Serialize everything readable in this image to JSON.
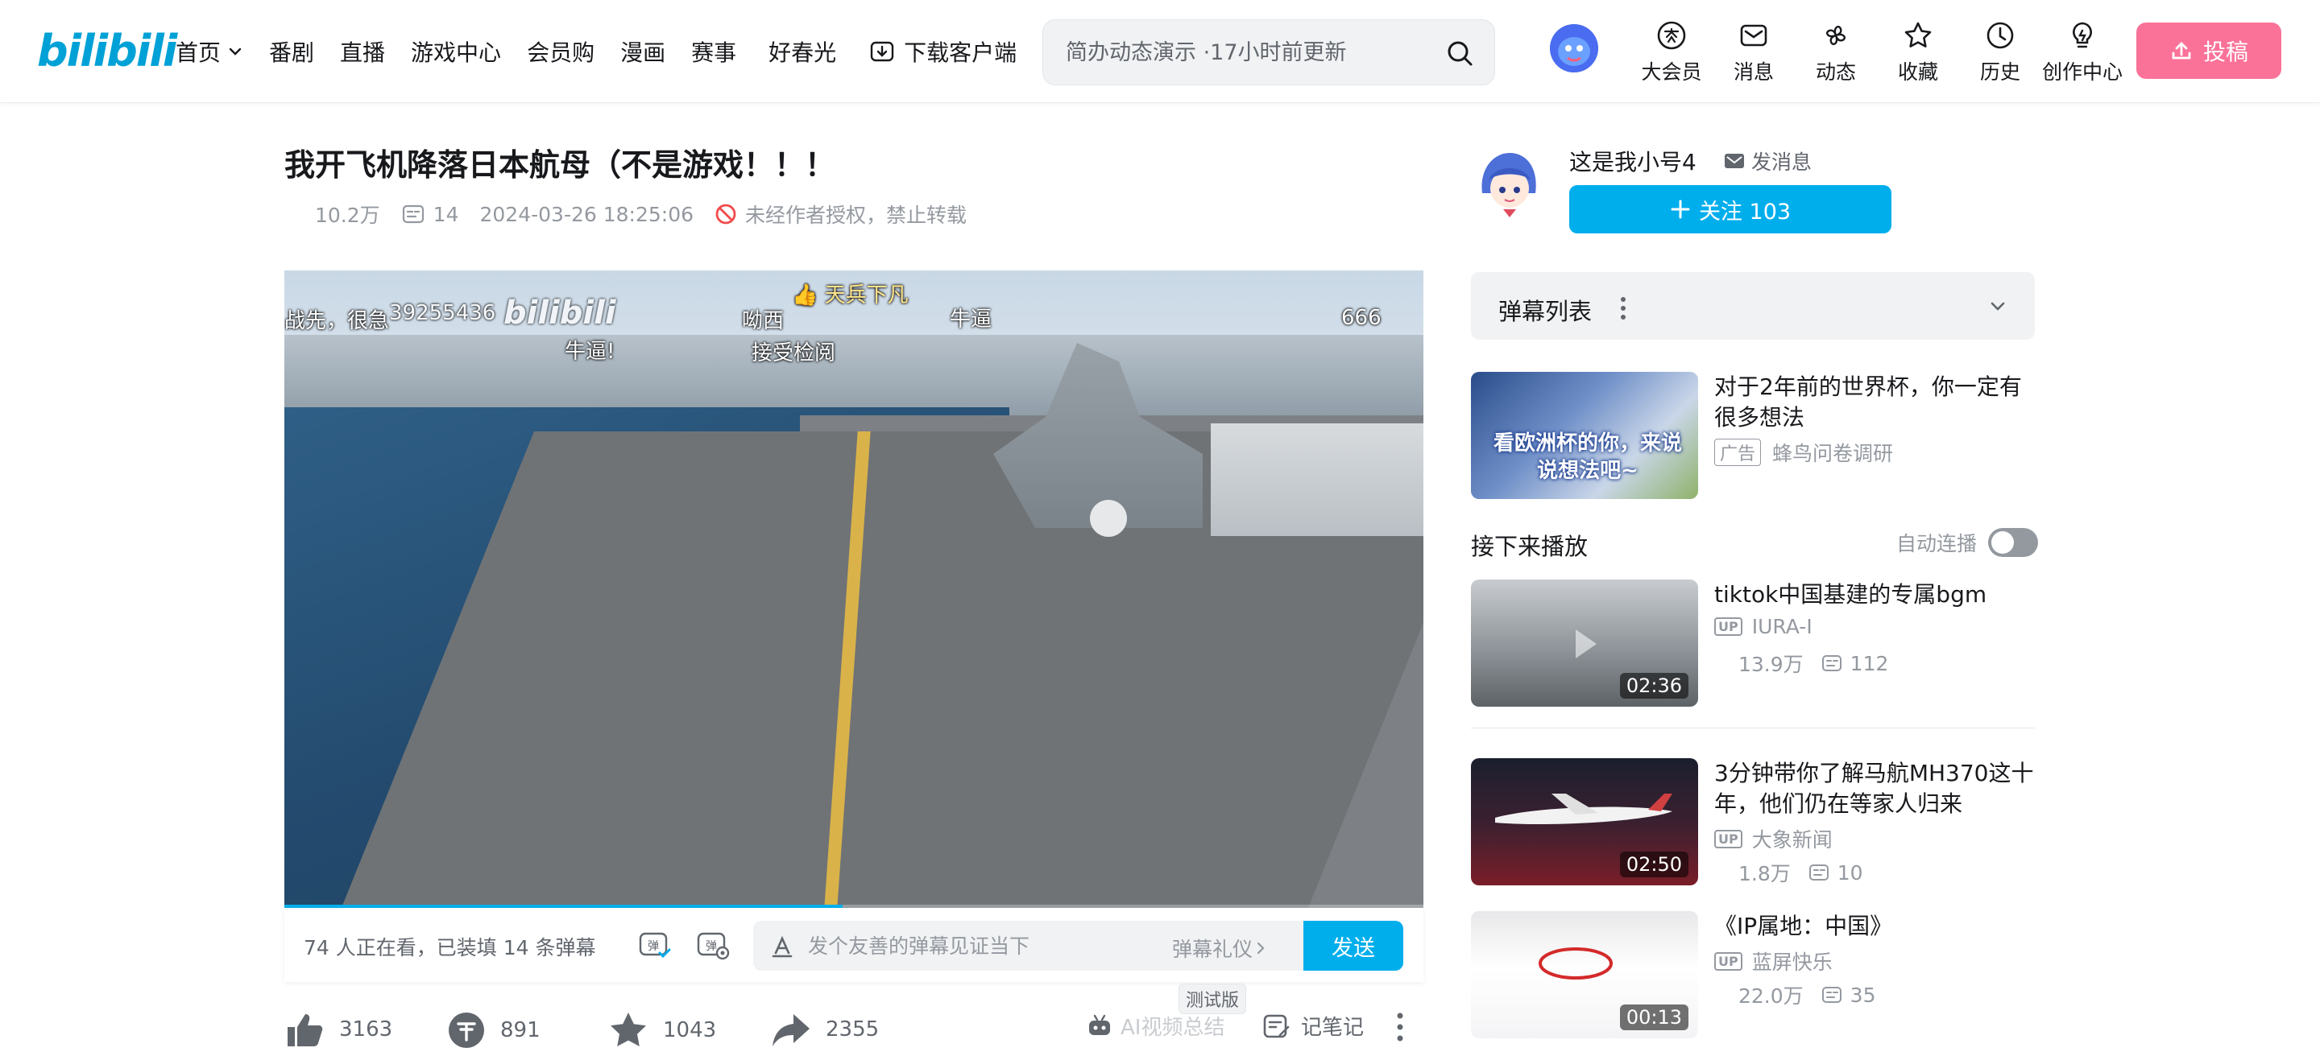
{
  "header": {
    "logo": "bilibili",
    "nav": [
      {
        "label": "首页"
      },
      {
        "label": "番剧"
      },
      {
        "label": "直播"
      },
      {
        "label": "游戏中心"
      },
      {
        "label": "会员购"
      },
      {
        "label": "漫画"
      },
      {
        "label": "赛事"
      },
      {
        "label": "好春光"
      },
      {
        "label": "下载客户端"
      }
    ],
    "search_placeholder": "简办动态演示 ·17小时前更新",
    "icons": [
      {
        "label": "大会员",
        "icon": "vip-icon"
      },
      {
        "label": "消息",
        "icon": "message-icon"
      },
      {
        "label": "动态",
        "icon": "dynamic-icon"
      },
      {
        "label": "收藏",
        "icon": "star-icon"
      },
      {
        "label": "历史",
        "icon": "clock-icon"
      },
      {
        "label": "创作中心",
        "icon": "bulb-icon"
      }
    ],
    "upload_label": "投稿"
  },
  "video": {
    "title": "我开飞机降落日本航母（不是游戏！！！",
    "views": "10.2万",
    "danmaku_count": "14",
    "date": "2024-03-26 18:25:06",
    "copyright": "未经作者授权，禁止转载",
    "danmaku_overlay": [
      {
        "text": "战先，很急"
      },
      {
        "text": "39255436"
      },
      {
        "text": "牛逼!"
      },
      {
        "text": "呦西"
      },
      {
        "text": "接受检阅"
      },
      {
        "text": "👍 天兵下凡"
      },
      {
        "text": "牛逼"
      },
      {
        "text": "666"
      }
    ],
    "watermark": "bilibili",
    "progress": 0.49
  },
  "send_bar": {
    "viewers": "74 人正在看，已装填 14 条弹幕",
    "placeholder": "发个友善的弹幕见证当下",
    "etiquette": "弹幕礼仪",
    "send_label": "发送"
  },
  "toolbar": {
    "like": "3163",
    "coin": "891",
    "favorite": "1043",
    "share": "2355",
    "ai_summary": "AI视频总结",
    "beta": "测试版",
    "notes": "记笔记"
  },
  "uploader": {
    "name": "这是我小号4",
    "message": "发消息",
    "follow": "关注 103"
  },
  "danmaku_list": {
    "title": "弹幕列表"
  },
  "ad": {
    "title": "对于2年前的世界杯，你一定有很多想法",
    "tag": "广告",
    "source": "蜂鸟问卷调研",
    "thumb_text": "看欧洲杯的你，来说说想法吧~"
  },
  "next_up": {
    "title": "接下来播放",
    "autoplay": "自动连播"
  },
  "recommendations": [
    {
      "title": "tiktok中国基建的专属bgm",
      "up": "IURA-I",
      "views": "13.9万",
      "danmaku": "112",
      "duration": "02:36"
    },
    {
      "title": "3分钟带你了解马航MH370这十年，他们仍在等家人归来",
      "up": "大象新闻",
      "views": "1.8万",
      "danmaku": "10",
      "duration": "02:50"
    },
    {
      "title": "《IP属地：中国》",
      "up": "蓝屏快乐",
      "views": "22.0万",
      "danmaku": "35",
      "duration": "00:13"
    }
  ],
  "colors": {
    "brand_blue": "#00aeec",
    "brand_pink": "#fb7299",
    "text_main": "#18191c",
    "text_gray": "#9499a0"
  }
}
